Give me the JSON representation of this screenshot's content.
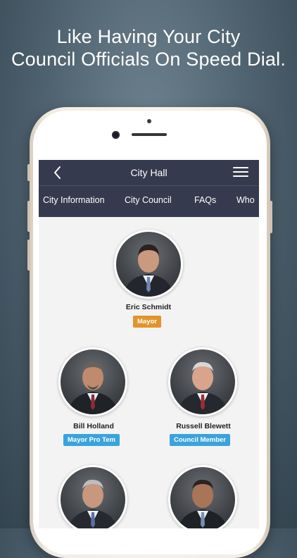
{
  "promo": {
    "line1": "Like Having Your City",
    "line2": "Council Officials On Speed Dial."
  },
  "navbar": {
    "title": "City Hall",
    "back_icon": "chevron-left-icon",
    "menu_icon": "hamburger-menu-icon"
  },
  "tabs": [
    {
      "label": "City Information",
      "active": false
    },
    {
      "label": "City Council",
      "active": true
    },
    {
      "label": "FAQs",
      "active": false
    },
    {
      "label": "Who",
      "active": false
    }
  ],
  "members": [
    {
      "name": "Eric Schmidt",
      "role": "Mayor",
      "role_color": "#e2942c"
    },
    {
      "name": "Bill Holland",
      "role": "Mayor Pro Tem",
      "role_color": "#3aa3dc"
    },
    {
      "name": "Russell Blewett",
      "role": "Council Member",
      "role_color": "#3aa3dc"
    },
    {
      "name": "",
      "role": ""
    },
    {
      "name": "",
      "role": ""
    }
  ],
  "colors": {
    "navbar_bg": "#353a4e",
    "mayor_badge": "#e2942c",
    "member_badge": "#3aa3dc"
  }
}
